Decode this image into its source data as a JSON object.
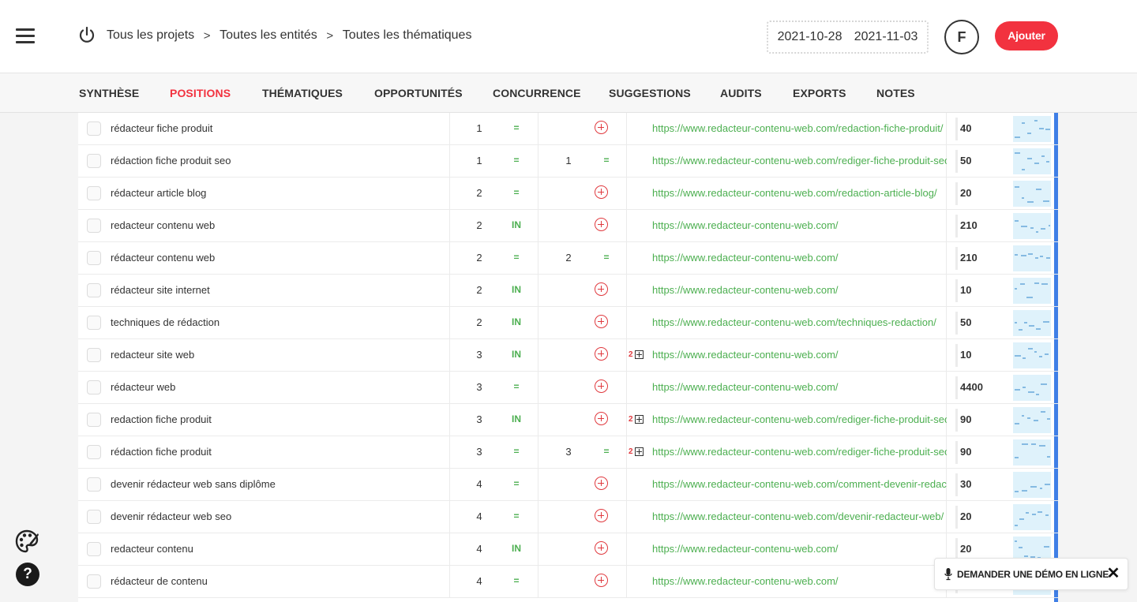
{
  "header": {
    "breadcrumb": [
      "Tous les projets",
      "Toutes les entités",
      "Toutes les thématiques"
    ],
    "separator": ">",
    "date_start": "2021-10-28",
    "date_end": "2021-11-03",
    "avatar_initial": "F",
    "add_label": "Ajouter"
  },
  "tabs": [
    "SYNTHÈSE",
    "POSITIONS",
    "THÉMATIQUES",
    "OPPORTUNITÉS",
    "CONCURRENCE",
    "SUGGESTIONS",
    "AUDITS",
    "EXPORTS",
    "NOTES"
  ],
  "active_tab": "POSITIONS",
  "rows": [
    {
      "keyword": "rédacteur fiche produit",
      "position": "1",
      "evolution": "=",
      "position2": "",
      "evolution2": "",
      "add": true,
      "count": "",
      "url": "https://www.redacteur-contenu-web.com/redaction-fiche-produit/",
      "volume": "40"
    },
    {
      "keyword": "rédaction fiche produit seo",
      "position": "1",
      "evolution": "=",
      "position2": "1",
      "evolution2": "=",
      "add": false,
      "count": "",
      "url": "https://www.redacteur-contenu-web.com/rediger-fiche-produit-seo/",
      "volume": "50"
    },
    {
      "keyword": "rédacteur article blog",
      "position": "2",
      "evolution": "=",
      "position2": "",
      "evolution2": "",
      "add": true,
      "count": "",
      "url": "https://www.redacteur-contenu-web.com/redaction-article-blog/",
      "volume": "20"
    },
    {
      "keyword": "redacteur contenu web",
      "position": "2",
      "evolution": "IN",
      "position2": "",
      "evolution2": "",
      "add": true,
      "count": "",
      "url": "https://www.redacteur-contenu-web.com/",
      "volume": "210"
    },
    {
      "keyword": "rédacteur contenu web",
      "position": "2",
      "evolution": "=",
      "position2": "2",
      "evolution2": "=",
      "add": false,
      "count": "",
      "url": "https://www.redacteur-contenu-web.com/",
      "volume": "210"
    },
    {
      "keyword": "rédacteur site internet",
      "position": "2",
      "evolution": "IN",
      "position2": "",
      "evolution2": "",
      "add": true,
      "count": "",
      "url": "https://www.redacteur-contenu-web.com/",
      "volume": "10"
    },
    {
      "keyword": "techniques de rédaction",
      "position": "2",
      "evolution": "IN",
      "position2": "",
      "evolution2": "",
      "add": true,
      "count": "",
      "url": "https://www.redacteur-contenu-web.com/techniques-redaction/",
      "volume": "50"
    },
    {
      "keyword": "redacteur site web",
      "position": "3",
      "evolution": "IN",
      "position2": "",
      "evolution2": "",
      "add": true,
      "count": "2",
      "url": "https://www.redacteur-contenu-web.com/",
      "volume": "10"
    },
    {
      "keyword": "rédacteur web",
      "position": "3",
      "evolution": "=",
      "position2": "",
      "evolution2": "",
      "add": true,
      "count": "",
      "url": "https://www.redacteur-contenu-web.com/",
      "volume": "4400"
    },
    {
      "keyword": "redaction fiche produit",
      "position": "3",
      "evolution": "IN",
      "position2": "",
      "evolution2": "",
      "add": true,
      "count": "2",
      "url": "https://www.redacteur-contenu-web.com/rediger-fiche-produit-seo/",
      "volume": "90"
    },
    {
      "keyword": "rédaction fiche produit",
      "position": "3",
      "evolution": "=",
      "position2": "3",
      "evolution2": "=",
      "add": false,
      "count": "2",
      "url": "https://www.redacteur-contenu-web.com/rediger-fiche-produit-seo/",
      "volume": "90"
    },
    {
      "keyword": "devenir rédacteur web sans diplôme",
      "position": "4",
      "evolution": "=",
      "position2": "",
      "evolution2": "",
      "add": true,
      "count": "",
      "url": "https://www.redacteur-contenu-web.com/comment-devenir-redacteur-web/",
      "volume": "30"
    },
    {
      "keyword": "devenir rédacteur web seo",
      "position": "4",
      "evolution": "=",
      "position2": "",
      "evolution2": "",
      "add": true,
      "count": "",
      "url": "https://www.redacteur-contenu-web.com/devenir-redacteur-web/",
      "volume": "20"
    },
    {
      "keyword": "redacteur contenu",
      "position": "4",
      "evolution": "IN",
      "position2": "",
      "evolution2": "",
      "add": true,
      "count": "",
      "url": "https://www.redacteur-contenu-web.com/",
      "volume": "20"
    },
    {
      "keyword": "rédacteur de contenu",
      "position": "4",
      "evolution": "=",
      "position2": "",
      "evolution2": "",
      "add": true,
      "count": "",
      "url": "https://www.redacteur-contenu-web.com/",
      "volume": ""
    }
  ],
  "demo": {
    "label": "DEMANDER UNE DÉMO EN LIGNE",
    "close": "✕"
  },
  "help_label": "?",
  "colors": {
    "accent": "#f2323f",
    "green": "#4caf50",
    "blue_edge": "#3f7fe6",
    "spark_bg": "#dff2fb"
  }
}
